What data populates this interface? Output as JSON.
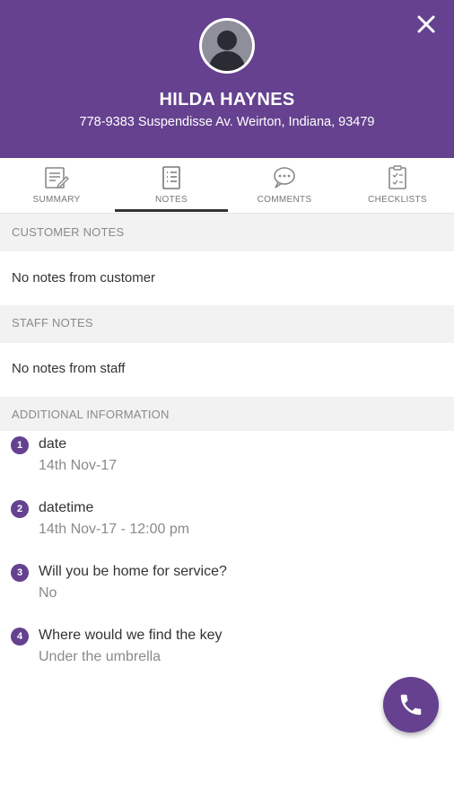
{
  "header": {
    "name": "HILDA HAYNES",
    "address": "778-9383 Suspendisse Av. Weirton, Indiana, 93479",
    "background_color": "#65418f"
  },
  "tabs": [
    {
      "label": "SUMMARY",
      "icon": "summary-icon",
      "active": false
    },
    {
      "label": "NOTES",
      "icon": "notes-icon",
      "active": true
    },
    {
      "label": "COMMENTS",
      "icon": "comments-icon",
      "active": false
    },
    {
      "label": "CHECKLISTS",
      "icon": "checklists-icon",
      "active": false
    }
  ],
  "customer_notes": {
    "title": "CUSTOMER NOTES",
    "text": "No notes from customer"
  },
  "staff_notes": {
    "title": "STAFF NOTES",
    "text": "No notes from staff"
  },
  "additional_info": {
    "title": "ADDITIONAL INFORMATION",
    "items": [
      {
        "number": "1",
        "label": "date",
        "value": "14th Nov-17"
      },
      {
        "number": "2",
        "label": "datetime",
        "value": "14th Nov-17 - 12:00 pm"
      },
      {
        "number": "3",
        "label": "Will you be home for service?",
        "value": "No"
      },
      {
        "number": "4",
        "label": "Where would we find the key",
        "value": "Under the umbrella"
      }
    ]
  },
  "fab": {
    "icon": "phone-icon"
  },
  "colors": {
    "accent": "#65418f",
    "section_bg": "#f2f2f2"
  }
}
